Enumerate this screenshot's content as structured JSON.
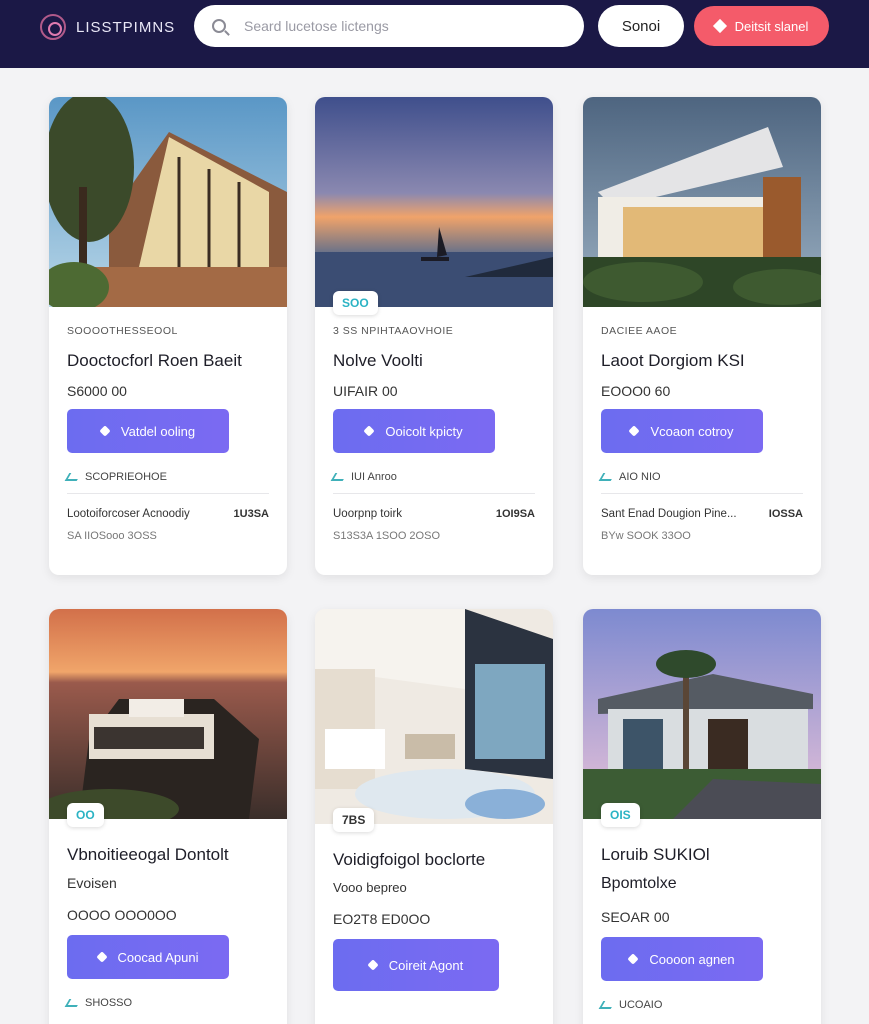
{
  "header": {
    "logo_text": "LISSTPIMNS",
    "search_placeholder": "Seard lucetose lictengs",
    "search_button": "Sonoi",
    "cta_button": "Deitsit slanel"
  },
  "listings": [
    {
      "badge": "",
      "category": "SOOOOTHESSEOOL",
      "title": "Dooctocforl Roen Baeit",
      "subtitle": "",
      "price": "S6000 00",
      "button": "Vatdel ooling",
      "meta": "SCOPRIEOHOE",
      "row_label": "Lootoiforcoser Acnoodiy",
      "row_value": "1U3SA",
      "sub": "SA IIOSooo 3OSS"
    },
    {
      "badge": "SOO",
      "category": "3 SS NPIHTAAOVHOIE",
      "title": "Nolve Voolti",
      "subtitle": "",
      "price": "UIFAIR 00",
      "button": "Ooicolt kpicty",
      "meta": "IUI Anroo",
      "row_label": "Uoorpnp toirk",
      "row_value": "1OI9SA",
      "sub": "S13S3A 1SOO 2OSO"
    },
    {
      "badge": "",
      "category": "DACIEE AAOE",
      "title": "Laoot Dorgiom KSI",
      "subtitle": "",
      "price": "EOOO0 60",
      "button": "Vcoaon cotroy",
      "meta": "AIO NIO",
      "row_label": "Sant Enad Dougion Pine...",
      "row_value": "IOSSA",
      "sub": "BYw SOOK 33OO"
    },
    {
      "badge": "OO",
      "category": "",
      "title": "Vbnoitieeogal Dontolt",
      "subtitle": "Evoisen",
      "price": "OOOO OOO0OO",
      "button": "Coocad Apuni",
      "meta": "SHOSSO",
      "row_label": "",
      "row_value": "",
      "sub": ""
    },
    {
      "badge": "7BS",
      "category": "",
      "title": "Voidigfoigol boclorte",
      "subtitle": "Vooo bepreo",
      "price": "EO2T8 ED0OO",
      "button": "Coireit Agont",
      "meta": "",
      "row_label": "",
      "row_value": "",
      "sub": ""
    },
    {
      "badge": "OIS",
      "category": "",
      "title": "Loruib SUKIOl",
      "subtitle": "Bpomtolxe",
      "price": "SEOAR 00",
      "button": "Coooon agnen",
      "meta": "UCOAIO",
      "row_label": "",
      "row_value": "",
      "sub": ""
    }
  ],
  "colors": {
    "header_bg": "#1b1846",
    "accent": "#6c6cf0",
    "cta": "#f45b6a",
    "badge_text": "#2bb3c4"
  }
}
